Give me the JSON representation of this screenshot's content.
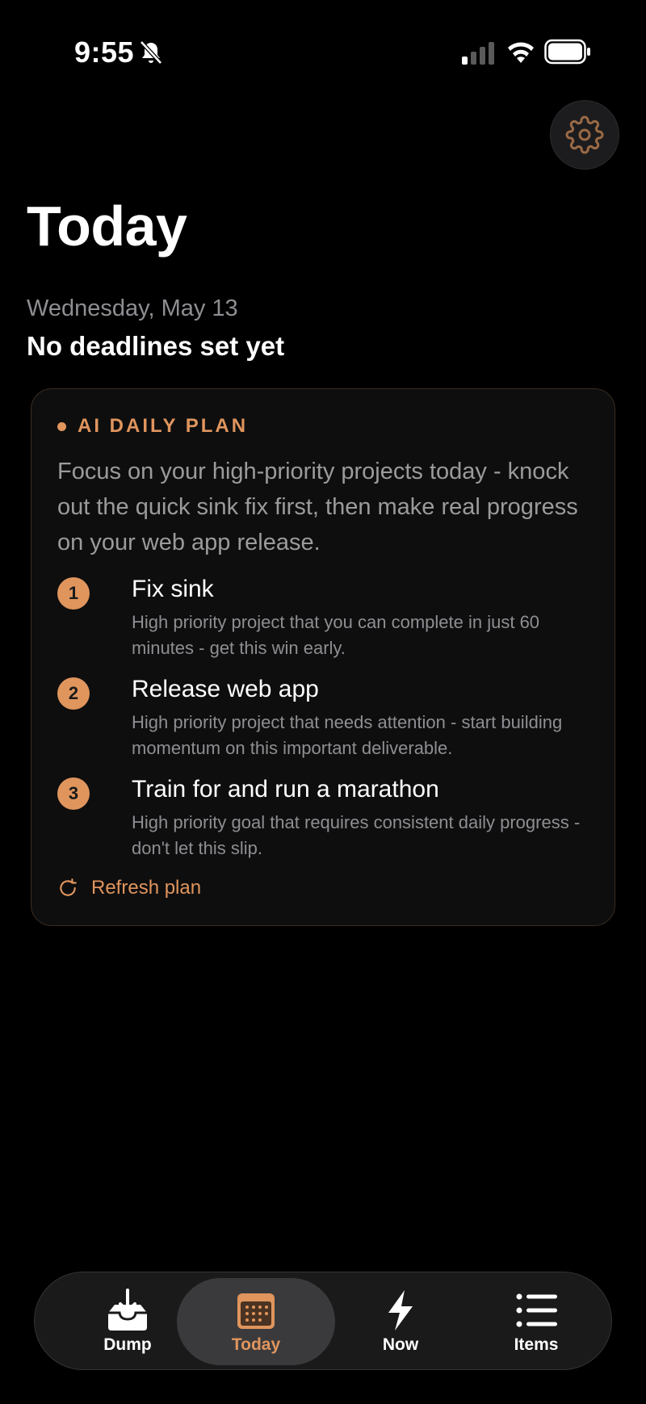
{
  "status_bar": {
    "time": "9:55"
  },
  "header": {
    "title": "Today",
    "date": "Wednesday, May 13",
    "deadline_status": "No deadlines set yet"
  },
  "plan": {
    "title": "AI DAILY PLAN",
    "summary": "Focus on your high-priority projects today - knock out the quick sink fix first, then make real progress on your web app release.",
    "items": [
      {
        "number": "1",
        "title": "Fix sink",
        "description": "High priority project that you can complete in just 60 minutes - get this win early."
      },
      {
        "number": "2",
        "title": "Release web app",
        "description": "High priority project that needs attention - start building momentum on this important deliverable."
      },
      {
        "number": "3",
        "title": "Train for and run a marathon",
        "description": "High priority goal that requires consistent daily progress - don't let this slip."
      }
    ],
    "refresh_label": "Refresh plan"
  },
  "tab_bar": {
    "tabs": [
      {
        "label": "Dump",
        "icon": "inbox-download-icon"
      },
      {
        "label": "Today",
        "icon": "calendar-icon",
        "active": true
      },
      {
        "label": "Now",
        "icon": "lightning-icon"
      },
      {
        "label": "Items",
        "icon": "list-icon"
      }
    ]
  },
  "colors": {
    "accent": "#e0955d",
    "background": "#000000",
    "card": "#0e0e0e",
    "muted_text": "#8e8e93"
  }
}
